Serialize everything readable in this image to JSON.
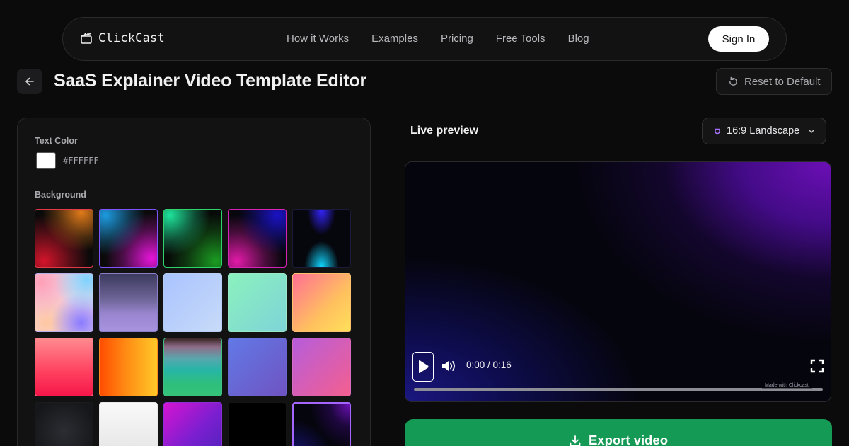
{
  "app": {
    "name": "ClickCast"
  },
  "nav": {
    "links": [
      "How it Works",
      "Examples",
      "Pricing",
      "Free Tools",
      "Blog"
    ],
    "signin_label": "Sign In"
  },
  "page": {
    "title": "SaaS Explainer Video Template Editor",
    "reset_label": "Reset to Default"
  },
  "editor": {
    "text_color_label": "Text Color",
    "text_color_value": "#FFFFFF",
    "background_label": "Background",
    "backgrounds": [
      {
        "name": "red-orange-glow"
      },
      {
        "name": "blue-magenta-glow"
      },
      {
        "name": "green-glow"
      },
      {
        "name": "blue-magenta-dark"
      },
      {
        "name": "blue-cyan-beam"
      },
      {
        "name": "pastel-mesh"
      },
      {
        "name": "lavender-mist"
      },
      {
        "name": "soft-blue"
      },
      {
        "name": "mint"
      },
      {
        "name": "pink-yellow"
      },
      {
        "name": "pink-red"
      },
      {
        "name": "orange-yellow"
      },
      {
        "name": "teal-stripes"
      },
      {
        "name": "indigo-violet"
      },
      {
        "name": "purple-pink"
      },
      {
        "name": "charcoal"
      },
      {
        "name": "white"
      },
      {
        "name": "magenta-purple"
      },
      {
        "name": "black"
      },
      {
        "name": "navy-purple-selected",
        "selected": true
      }
    ]
  },
  "preview": {
    "label": "Live preview",
    "aspect_label": "16:9 Landscape",
    "time": "0:00 / 0:16",
    "watermark": "Made with Clickcast",
    "progress": 0
  },
  "export_label": "Export video",
  "colors": {
    "accent": "#159a55",
    "selected_tile": "#a566ff"
  }
}
